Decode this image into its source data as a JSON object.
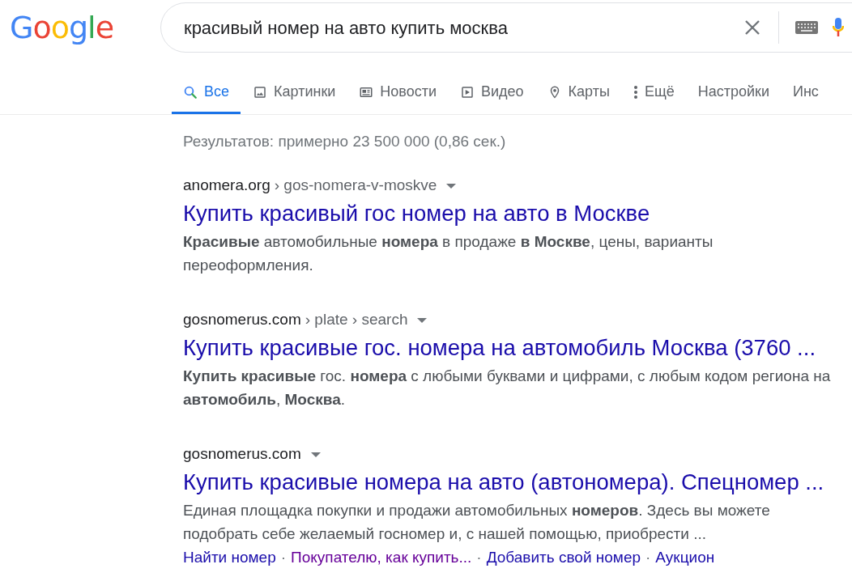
{
  "logo": {
    "text": "Google"
  },
  "search": {
    "value": "красивый номер на авто купить москва"
  },
  "tabs": [
    {
      "label": "Все",
      "kind": "search",
      "selected": true
    },
    {
      "label": "Картинки",
      "kind": "image",
      "selected": false
    },
    {
      "label": "Новости",
      "kind": "news",
      "selected": false
    },
    {
      "label": "Видео",
      "kind": "video",
      "selected": false
    },
    {
      "label": "Карты",
      "kind": "pin",
      "selected": false
    },
    {
      "label": "Ещё",
      "kind": "more",
      "selected": false
    },
    {
      "label": "Настройки",
      "kind": "plain",
      "selected": false
    },
    {
      "label": "Инс",
      "kind": "plain",
      "selected": false
    }
  ],
  "stats": "Результатов: примерно 23 500 000 (0,86 сек.)",
  "results": [
    {
      "domain": "anomera.org",
      "path": "› gos-nomera-v-moskve",
      "title": "Купить красивый гос номер на авто в Москве",
      "snippet": "**Красивые** автомобильные **номера** в продаже **в Москве**, цены, варианты переоформления."
    },
    {
      "domain": "gosnomerus.com",
      "path": "› plate › search",
      "title": "Купить красивые гос. номера на автомобиль Москва (3760 ...",
      "snippet": "**Купить красивые** гос. **номера** с любыми буквами и цифрами, с любым кодом региона на **автомобиль**, **Москва**."
    },
    {
      "domain": "gosnomerus.com",
      "title": "Купить красивые номера на авто (автономера). Спецномер ...",
      "snippet": "Единая площадка покупки и продажи автомобильных **номеров**. Здесь вы можете подобрать себе желаемый госномер и, с нашей помощью, приобрести ...",
      "sitelinks": [
        {
          "label": "Найти номер",
          "visited": false
        },
        {
          "separator": "·",
          "label": "Покупателю, как купить...",
          "visited": true
        },
        {
          "separator": "·",
          "label": "Добавить свой номер",
          "visited": false
        },
        {
          "separator": "·",
          "label": "Аукцион",
          "visited": false
        }
      ]
    }
  ]
}
